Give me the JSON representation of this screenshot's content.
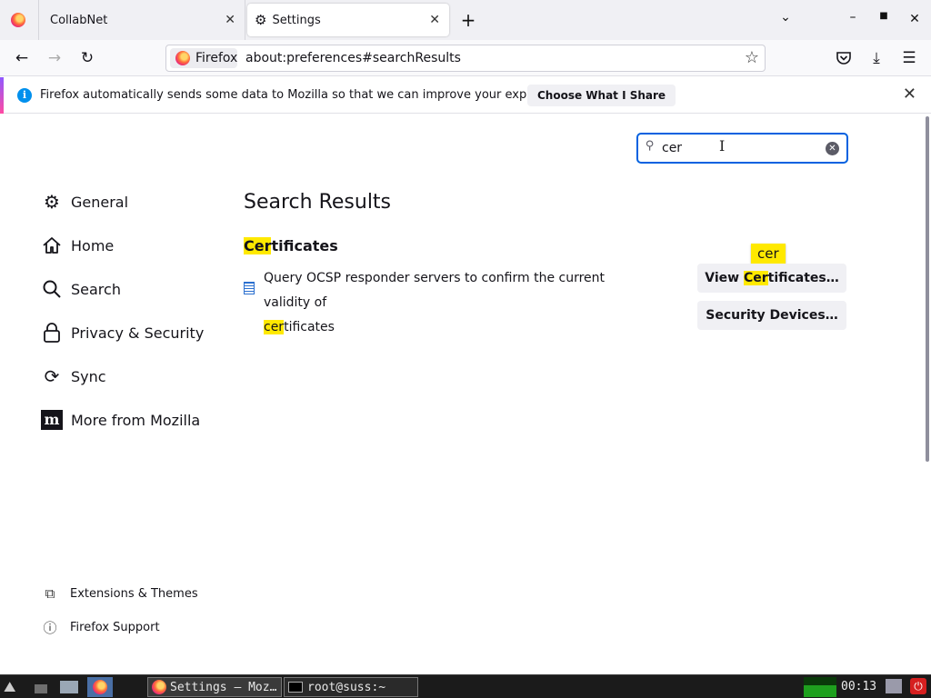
{
  "tabs": [
    {
      "label": "CollabNet"
    },
    {
      "label": "Settings"
    }
  ],
  "navbar": {
    "identity_label": "Firefox",
    "url": "about:preferences#searchResults"
  },
  "notification": {
    "text": "Firefox automatically sends some data to Mozilla so that we can improve your experience.",
    "button": "Choose What I Share"
  },
  "search": {
    "value": "cer"
  },
  "sidebar": {
    "categories": [
      {
        "label": "General",
        "icon": "gear-icon"
      },
      {
        "label": "Home",
        "icon": "home-icon"
      },
      {
        "label": "Search",
        "icon": "search-icon"
      },
      {
        "label": "Privacy & Security",
        "icon": "lock-icon"
      },
      {
        "label": "Sync",
        "icon": "sync-icon"
      },
      {
        "label": "More from Mozilla",
        "icon": "mozilla-m-icon"
      }
    ],
    "footer": [
      {
        "label": "Extensions & Themes",
        "icon": "puzzle-icon"
      },
      {
        "label": "Firefox Support",
        "icon": "help-icon"
      }
    ]
  },
  "main": {
    "title": "Search Results",
    "section_highlight": "Cer",
    "section_rest": "tificates",
    "ocsp_line1": "Query OCSP responder servers to confirm the current validity of",
    "ocsp_highlight": "cer",
    "ocsp_rest": "tificates",
    "bubble": "cer",
    "view_cert_pre": "View ",
    "view_cert_highlight": "Cer",
    "view_cert_post": "tificates…",
    "security_devices": "Security Devices…"
  },
  "taskbar": {
    "tasks": [
      {
        "label": "Settings — Moz…"
      },
      {
        "label": "root@suss:~"
      }
    ],
    "clock": "00:13"
  },
  "colors": {
    "accent": "#0061e0",
    "highlight": "#ffe900",
    "info": "#0090ed"
  }
}
